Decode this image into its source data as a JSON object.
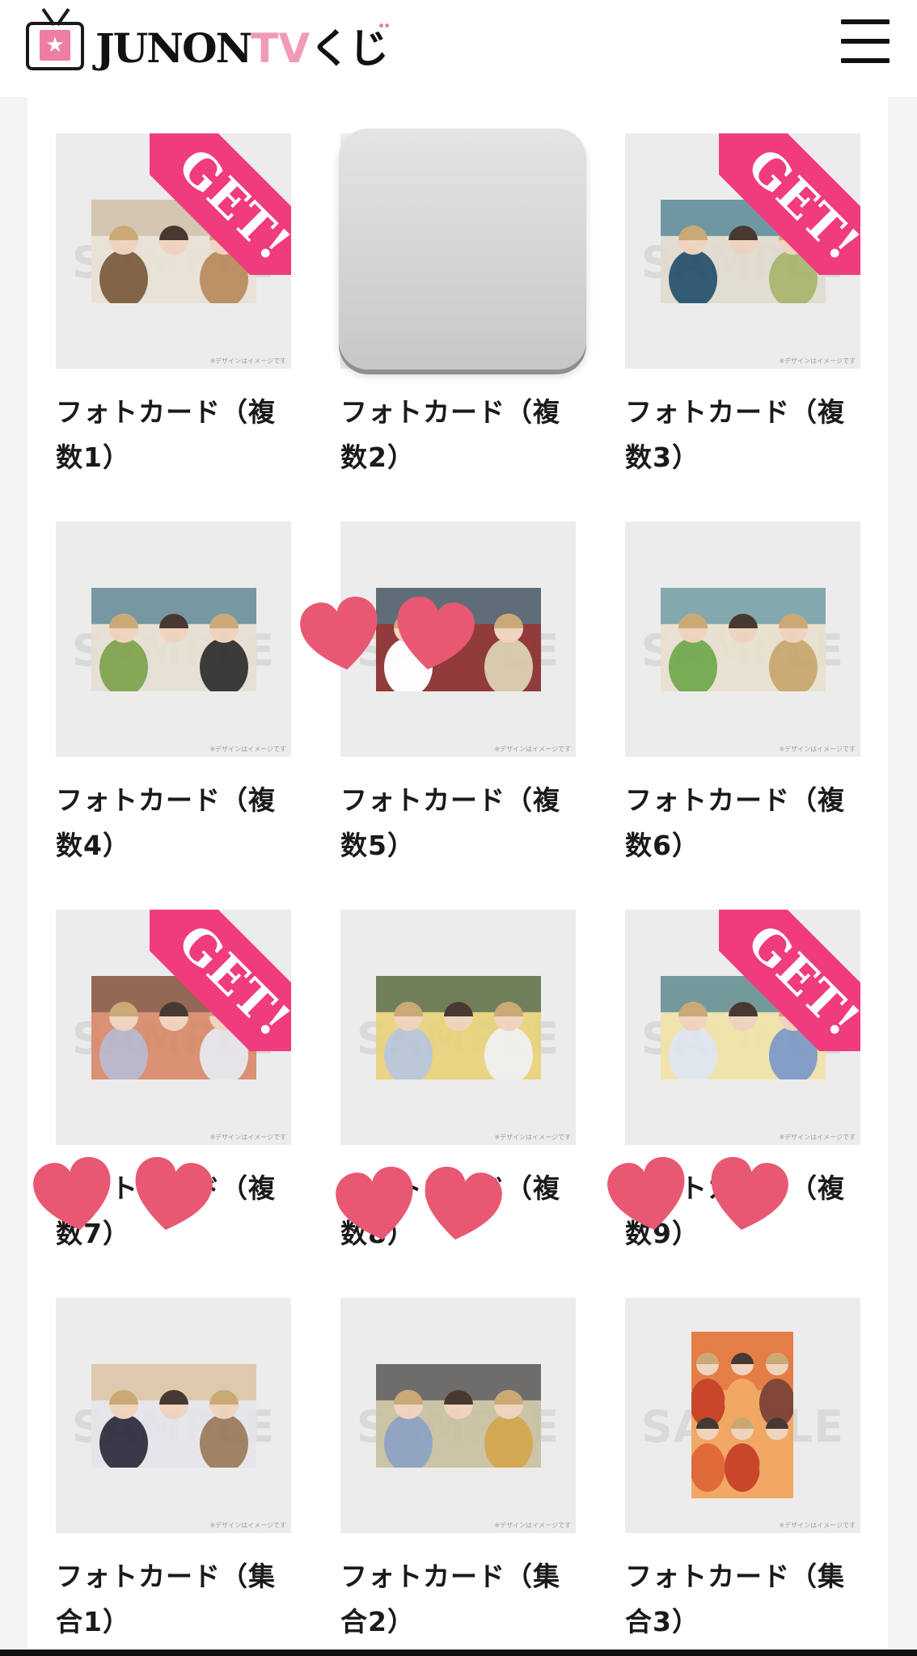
{
  "header": {
    "brand_main": "JUNON",
    "brand_tv": "TV",
    "brand_kuji": "くじ",
    "logo_icon": "tv-star-icon",
    "menu_icon": "hamburger-menu-icon"
  },
  "colors": {
    "accent_pink": "#f03b7d",
    "logo_pink": "#f09bb5",
    "heart": "#e85873",
    "card_bg": "#ececed"
  },
  "card_common": {
    "watermark": "SAMPLE",
    "note": "※デザインはイメージです",
    "get_ribbon": "GET!"
  },
  "items": [
    {
      "line1": "フォトカード（複",
      "line2": "数1）",
      "get": true
    },
    {
      "line1": "フォトカード（複",
      "line2": "数2）",
      "get": false
    },
    {
      "line1": "フォトカード（複",
      "line2": "数3）",
      "get": true
    },
    {
      "line1": "フォトカード（複",
      "line2": "数4）",
      "get": false
    },
    {
      "line1": "フォトカード（複",
      "line2": "数5）",
      "get": false
    },
    {
      "line1": "フォトカード（複",
      "line2": "数6）",
      "get": false
    },
    {
      "line1": "フォトカード（複",
      "line2": "数7）",
      "get": true
    },
    {
      "line1": "フォトカード（複",
      "line2": "数8）",
      "get": false
    },
    {
      "line1": "フォトカード（複",
      "line2": "数9）",
      "get": true
    },
    {
      "line1": "フォトカード（集",
      "line2": "合1）",
      "get": false
    },
    {
      "line1": "フォトカード（集",
      "line2": "合2）",
      "get": false
    },
    {
      "line1": "フォトカード（集",
      "line2": "合3）",
      "get": false
    }
  ]
}
